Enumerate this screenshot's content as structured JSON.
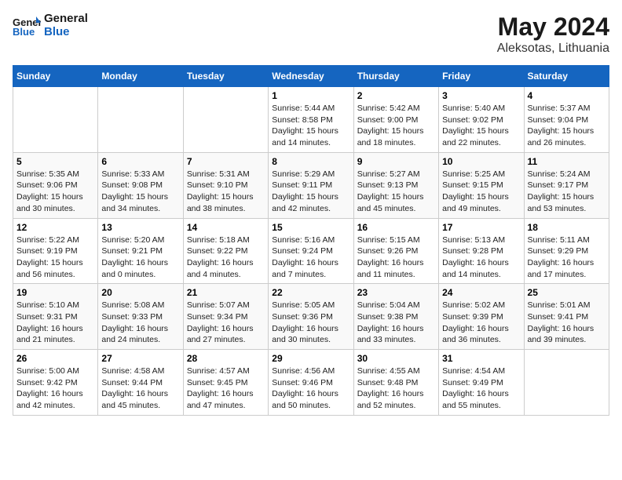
{
  "header": {
    "logo_general": "General",
    "logo_blue": "Blue",
    "month_title": "May 2024",
    "location": "Aleksotas, Lithuania"
  },
  "days_of_week": [
    "Sunday",
    "Monday",
    "Tuesday",
    "Wednesday",
    "Thursday",
    "Friday",
    "Saturday"
  ],
  "weeks": [
    [
      {
        "day": "",
        "info": ""
      },
      {
        "day": "",
        "info": ""
      },
      {
        "day": "",
        "info": ""
      },
      {
        "day": "1",
        "info": "Sunrise: 5:44 AM\nSunset: 8:58 PM\nDaylight: 15 hours\nand 14 minutes."
      },
      {
        "day": "2",
        "info": "Sunrise: 5:42 AM\nSunset: 9:00 PM\nDaylight: 15 hours\nand 18 minutes."
      },
      {
        "day": "3",
        "info": "Sunrise: 5:40 AM\nSunset: 9:02 PM\nDaylight: 15 hours\nand 22 minutes."
      },
      {
        "day": "4",
        "info": "Sunrise: 5:37 AM\nSunset: 9:04 PM\nDaylight: 15 hours\nand 26 minutes."
      }
    ],
    [
      {
        "day": "5",
        "info": "Sunrise: 5:35 AM\nSunset: 9:06 PM\nDaylight: 15 hours\nand 30 minutes."
      },
      {
        "day": "6",
        "info": "Sunrise: 5:33 AM\nSunset: 9:08 PM\nDaylight: 15 hours\nand 34 minutes."
      },
      {
        "day": "7",
        "info": "Sunrise: 5:31 AM\nSunset: 9:10 PM\nDaylight: 15 hours\nand 38 minutes."
      },
      {
        "day": "8",
        "info": "Sunrise: 5:29 AM\nSunset: 9:11 PM\nDaylight: 15 hours\nand 42 minutes."
      },
      {
        "day": "9",
        "info": "Sunrise: 5:27 AM\nSunset: 9:13 PM\nDaylight: 15 hours\nand 45 minutes."
      },
      {
        "day": "10",
        "info": "Sunrise: 5:25 AM\nSunset: 9:15 PM\nDaylight: 15 hours\nand 49 minutes."
      },
      {
        "day": "11",
        "info": "Sunrise: 5:24 AM\nSunset: 9:17 PM\nDaylight: 15 hours\nand 53 minutes."
      }
    ],
    [
      {
        "day": "12",
        "info": "Sunrise: 5:22 AM\nSunset: 9:19 PM\nDaylight: 15 hours\nand 56 minutes."
      },
      {
        "day": "13",
        "info": "Sunrise: 5:20 AM\nSunset: 9:21 PM\nDaylight: 16 hours\nand 0 minutes."
      },
      {
        "day": "14",
        "info": "Sunrise: 5:18 AM\nSunset: 9:22 PM\nDaylight: 16 hours\nand 4 minutes."
      },
      {
        "day": "15",
        "info": "Sunrise: 5:16 AM\nSunset: 9:24 PM\nDaylight: 16 hours\nand 7 minutes."
      },
      {
        "day": "16",
        "info": "Sunrise: 5:15 AM\nSunset: 9:26 PM\nDaylight: 16 hours\nand 11 minutes."
      },
      {
        "day": "17",
        "info": "Sunrise: 5:13 AM\nSunset: 9:28 PM\nDaylight: 16 hours\nand 14 minutes."
      },
      {
        "day": "18",
        "info": "Sunrise: 5:11 AM\nSunset: 9:29 PM\nDaylight: 16 hours\nand 17 minutes."
      }
    ],
    [
      {
        "day": "19",
        "info": "Sunrise: 5:10 AM\nSunset: 9:31 PM\nDaylight: 16 hours\nand 21 minutes."
      },
      {
        "day": "20",
        "info": "Sunrise: 5:08 AM\nSunset: 9:33 PM\nDaylight: 16 hours\nand 24 minutes."
      },
      {
        "day": "21",
        "info": "Sunrise: 5:07 AM\nSunset: 9:34 PM\nDaylight: 16 hours\nand 27 minutes."
      },
      {
        "day": "22",
        "info": "Sunrise: 5:05 AM\nSunset: 9:36 PM\nDaylight: 16 hours\nand 30 minutes."
      },
      {
        "day": "23",
        "info": "Sunrise: 5:04 AM\nSunset: 9:38 PM\nDaylight: 16 hours\nand 33 minutes."
      },
      {
        "day": "24",
        "info": "Sunrise: 5:02 AM\nSunset: 9:39 PM\nDaylight: 16 hours\nand 36 minutes."
      },
      {
        "day": "25",
        "info": "Sunrise: 5:01 AM\nSunset: 9:41 PM\nDaylight: 16 hours\nand 39 minutes."
      }
    ],
    [
      {
        "day": "26",
        "info": "Sunrise: 5:00 AM\nSunset: 9:42 PM\nDaylight: 16 hours\nand 42 minutes."
      },
      {
        "day": "27",
        "info": "Sunrise: 4:58 AM\nSunset: 9:44 PM\nDaylight: 16 hours\nand 45 minutes."
      },
      {
        "day": "28",
        "info": "Sunrise: 4:57 AM\nSunset: 9:45 PM\nDaylight: 16 hours\nand 47 minutes."
      },
      {
        "day": "29",
        "info": "Sunrise: 4:56 AM\nSunset: 9:46 PM\nDaylight: 16 hours\nand 50 minutes."
      },
      {
        "day": "30",
        "info": "Sunrise: 4:55 AM\nSunset: 9:48 PM\nDaylight: 16 hours\nand 52 minutes."
      },
      {
        "day": "31",
        "info": "Sunrise: 4:54 AM\nSunset: 9:49 PM\nDaylight: 16 hours\nand 55 minutes."
      },
      {
        "day": "",
        "info": ""
      }
    ]
  ]
}
